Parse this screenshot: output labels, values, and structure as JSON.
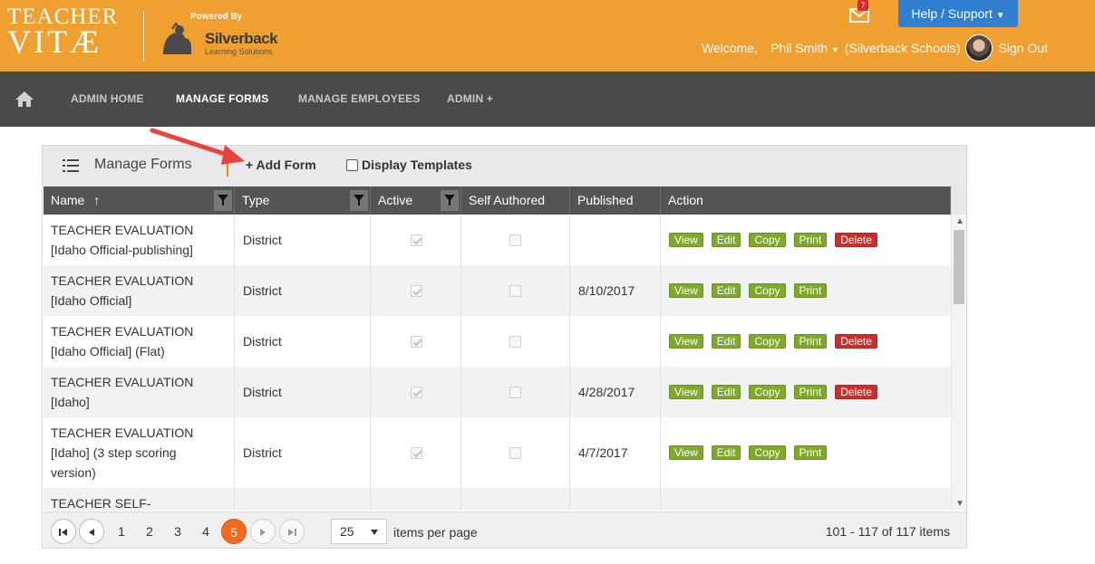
{
  "brand": {
    "logo_line1": "TEACHER",
    "logo_line2": "VITÆ",
    "powered_by": "Powered By",
    "partner_name": "Silverback",
    "partner_sub": "Learning Solutions"
  },
  "header": {
    "mail_count": "7",
    "help_label": "Help / Support",
    "welcome": "Welcome,",
    "user_name": "Phil Smith",
    "org": "(Silverback Schools)",
    "sign_out": "Sign Out"
  },
  "nav": {
    "items": [
      "ADMIN HOME",
      "MANAGE FORMS",
      "MANAGE EMPLOYEES",
      "ADMIN +"
    ],
    "active": "MANAGE FORMS"
  },
  "panel": {
    "title": "Manage Forms",
    "add_form": "+ Add Form",
    "display_templates": "Display Templates"
  },
  "grid": {
    "columns": [
      "Name",
      "Type",
      "Active",
      "Self Authored",
      "Published",
      "Action"
    ],
    "rows": [
      {
        "name1": "TEACHER EVALUATION",
        "name2": "[Idaho Official-publishing]",
        "name3": "",
        "type": "District",
        "active": true,
        "self": false,
        "published": "",
        "actions": [
          "View",
          "Edit",
          "Copy",
          "Print",
          "Delete"
        ]
      },
      {
        "name1": "TEACHER EVALUATION",
        "name2": "[Idaho Official]",
        "name3": "",
        "type": "District",
        "active": true,
        "self": false,
        "published": "8/10/2017",
        "actions": [
          "View",
          "Edit",
          "Copy",
          "Print"
        ]
      },
      {
        "name1": "TEACHER EVALUATION",
        "name2": "[Idaho Official] (Flat)",
        "name3": "",
        "type": "District",
        "active": true,
        "self": false,
        "published": "",
        "actions": [
          "View",
          "Edit",
          "Copy",
          "Print",
          "Delete"
        ]
      },
      {
        "name1": "TEACHER EVALUATION",
        "name2": "[Idaho]",
        "name3": "",
        "type": "District",
        "active": true,
        "self": false,
        "published": "4/28/2017",
        "actions": [
          "View",
          "Edit",
          "Copy",
          "Print",
          "Delete"
        ]
      },
      {
        "name1": "TEACHER EVALUATION",
        "name2": "[Idaho] (3 step scoring",
        "name3": "version)",
        "type": "District",
        "active": true,
        "self": false,
        "published": "4/7/2017",
        "actions": [
          "View",
          "Edit",
          "Copy",
          "Print"
        ]
      },
      {
        "name1": "TEACHER SELF-",
        "name2": "",
        "name3": "",
        "type": "",
        "active": null,
        "self": null,
        "published": "",
        "actions": []
      }
    ]
  },
  "pager": {
    "pages": [
      "1",
      "2",
      "3",
      "4",
      "5"
    ],
    "current": "5",
    "page_size": "25",
    "items_per_page": "items per page",
    "info": "101 - 117 of 117 items"
  },
  "colors": {
    "header_bg": "#f0a030",
    "nav_bg": "#4a4a4a",
    "help_btn": "#2f7ed0",
    "action_green": "#7fa92a",
    "action_red": "#c9302c",
    "current_page": "#f26b1d",
    "annotation_arrow": "#e8433c"
  }
}
